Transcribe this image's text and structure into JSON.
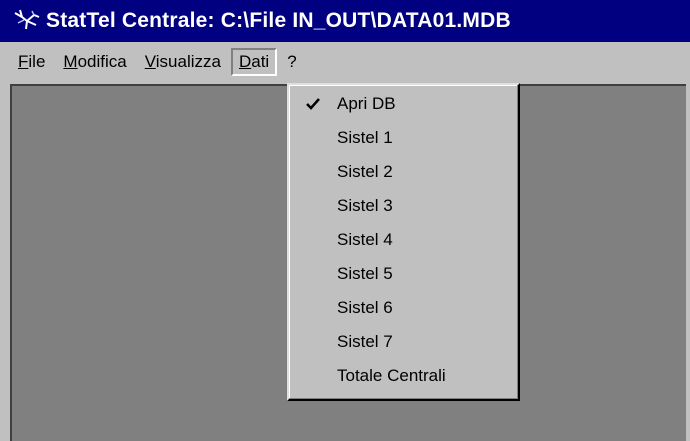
{
  "window": {
    "title": "StatTel Centrale: C:\\File IN_OUT\\DATA01.MDB",
    "icon": "app-icon"
  },
  "menubar": {
    "items": [
      {
        "label_u": "F",
        "label_rest": "ile"
      },
      {
        "label_u": "M",
        "label_rest": "odifica"
      },
      {
        "label_u": "V",
        "label_rest": "isualizza"
      },
      {
        "label_u": "D",
        "label_rest": "ati"
      },
      {
        "label_u": "",
        "label_rest": "?"
      }
    ]
  },
  "dropdown": {
    "items": [
      {
        "label": "Apri DB",
        "checked": true
      },
      {
        "label": "Sistel 1"
      },
      {
        "label": "Sistel 2"
      },
      {
        "label": "Sistel 3"
      },
      {
        "label": "Sistel 4"
      },
      {
        "label": "Sistel 5"
      },
      {
        "label": "Sistel 6"
      },
      {
        "label": "Sistel 7"
      },
      {
        "label": "Totale Centrali"
      }
    ]
  },
  "colors": {
    "titlebar": "#000080",
    "face": "#c0c0c0",
    "workspace": "#808080"
  }
}
